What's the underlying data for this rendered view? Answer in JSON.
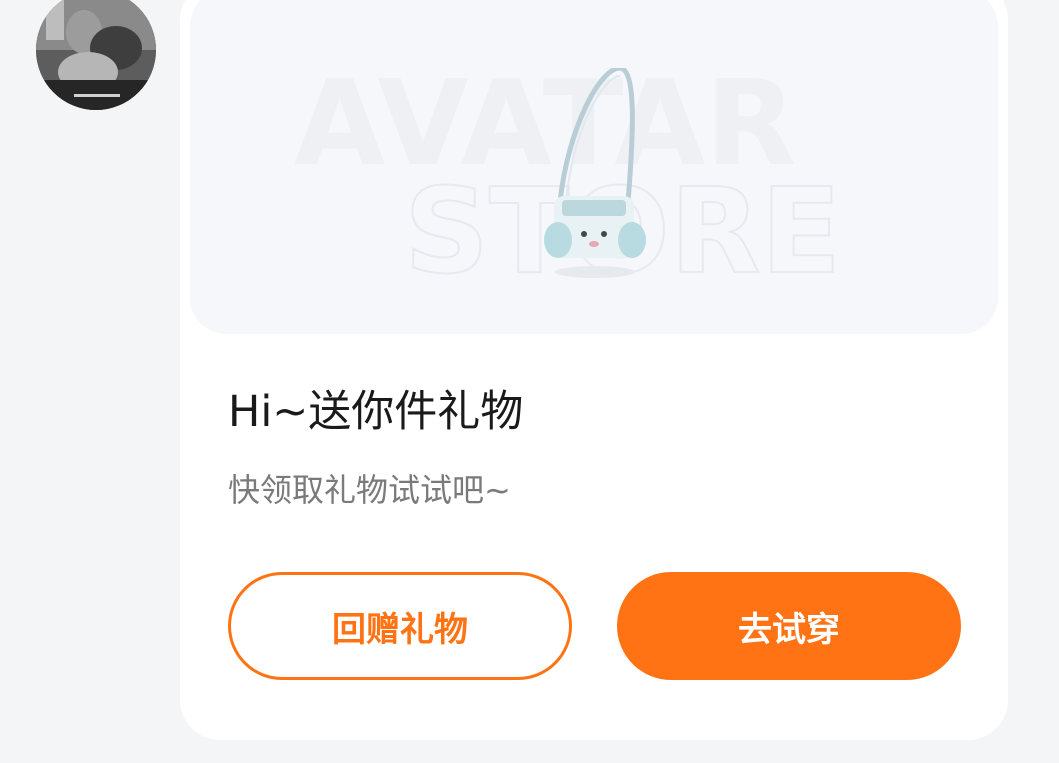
{
  "avatar": {
    "icon": "user-avatar-photo"
  },
  "gift_card": {
    "watermark_line1": "AVATAR",
    "watermark_line2": "STORE",
    "product_image": {
      "icon": "shoulder-bag-image"
    },
    "title": "Hi~送你件礼物",
    "subtitle": "快领取礼物试试吧~",
    "return_gift_button": "回赠礼物",
    "try_on_button": "去试穿"
  },
  "colors": {
    "accent": "#ff7314",
    "page_background": "#f4f5f7",
    "card_background": "#ffffff",
    "panel_background": "#f6f7fa",
    "title_text": "#1a1a1a",
    "subtitle_text": "#7a7a7a"
  }
}
